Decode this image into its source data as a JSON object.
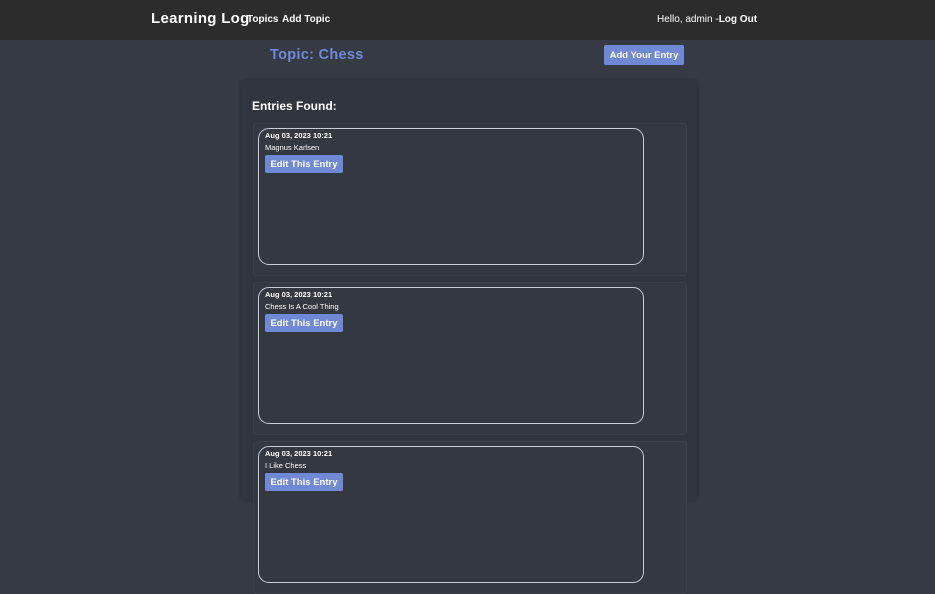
{
  "navbar": {
    "brand": "Learning Log",
    "links": [
      "Topics",
      "Add Topic"
    ],
    "greeting": "Hello, admin -",
    "logout": "Log Out"
  },
  "topic": {
    "title": "Topic: Chess",
    "add_entry_label": "Add Your Entry"
  },
  "entries_heading": "Entries Found:",
  "entries": [
    {
      "date": "Aug 03, 2023 10:21",
      "text": "Magnus Karlsen",
      "edit_label": "Edit This Entry"
    },
    {
      "date": "Aug 03, 2023 10:21",
      "text": "Chess Is A Cool Thing",
      "edit_label": "Edit This Entry"
    },
    {
      "date": "Aug 03, 2023 10:21",
      "text": "I Like Chess",
      "edit_label": "Edit This Entry"
    }
  ],
  "colors": {
    "background": "#363a43",
    "navbar": "#2c2c2c",
    "accent": "#7089d5",
    "topic_title": "#6f89d9"
  }
}
